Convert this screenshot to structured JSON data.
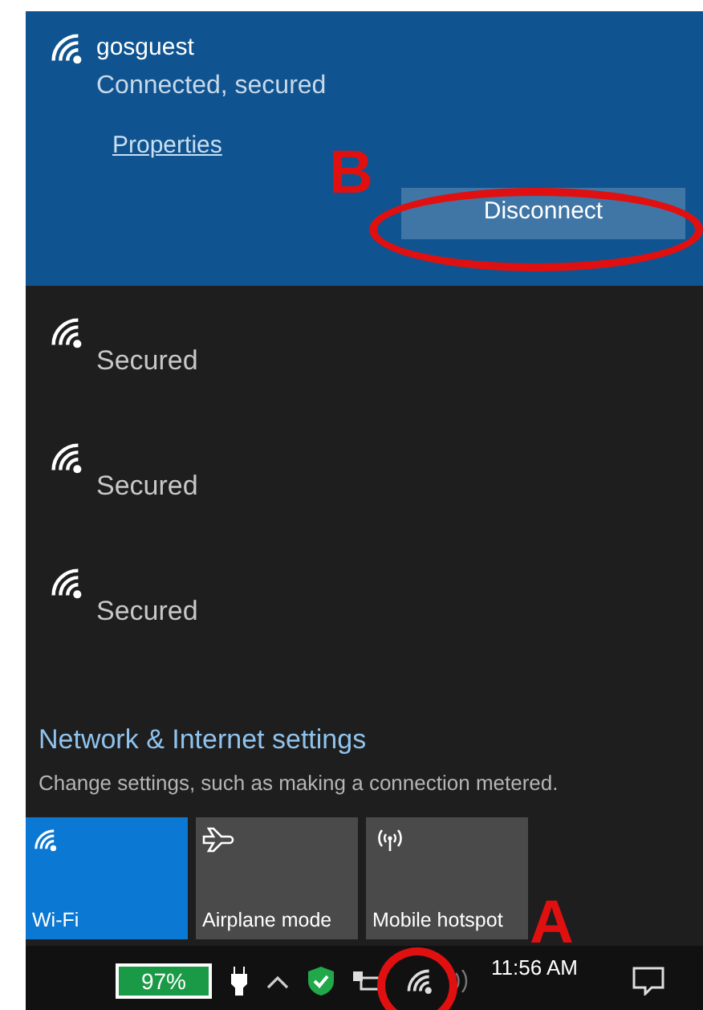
{
  "connected": {
    "name": "gosguest",
    "status": "Connected, secured",
    "link": "Properties",
    "button": "Disconnect",
    "annotation": "B"
  },
  "networks": [
    {
      "status": "Secured"
    },
    {
      "status": "Secured"
    },
    {
      "status": "Secured"
    }
  ],
  "settings": {
    "title": "Network & Internet settings",
    "description": "Change settings, such as making a connection metered."
  },
  "tiles": [
    {
      "kind": "wifi",
      "label": "Wi-Fi",
      "on": true
    },
    {
      "kind": "airplane",
      "label": "Airplane mode",
      "on": false
    },
    {
      "kind": "hotspot",
      "label": "Mobile hotspot",
      "on": false
    }
  ],
  "taskbar": {
    "battery": "97%",
    "time": "11:56 AM",
    "annotation": "A"
  }
}
